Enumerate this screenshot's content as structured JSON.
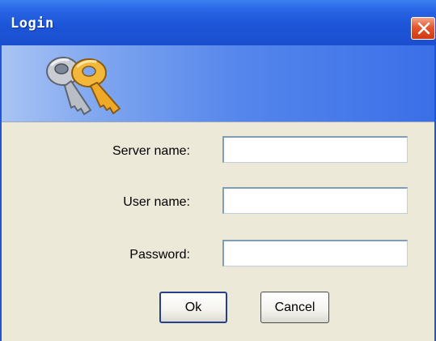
{
  "window": {
    "title": "Login",
    "close_icon": "close-icon",
    "banner_icon": "keys-icon"
  },
  "form": {
    "server": {
      "label": "Server name:",
      "value": "",
      "placeholder": ""
    },
    "user": {
      "label": "User name:",
      "value": "",
      "placeholder": ""
    },
    "password": {
      "label": "Password:",
      "value": "",
      "placeholder": ""
    }
  },
  "buttons": {
    "ok_label": "Ok",
    "cancel_label": "Cancel"
  },
  "colors": {
    "titlebar": "#1d55d8",
    "close_button": "#e5552c",
    "dialog_bg": "#ece9d8",
    "banner": "#5586ec"
  }
}
